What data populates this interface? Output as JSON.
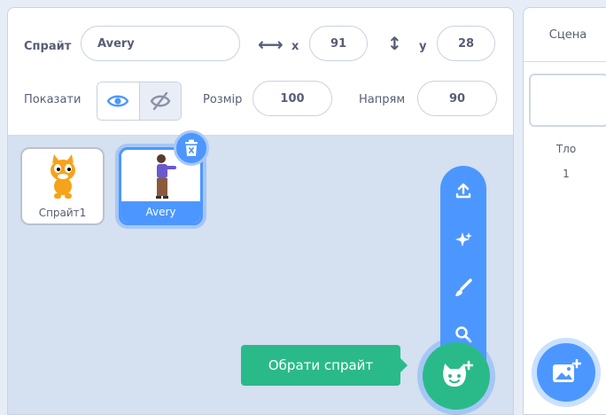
{
  "sprite_info": {
    "sprite_label": "Спрайт",
    "sprite_name": "Avery",
    "x_label": "x",
    "x_value": "91",
    "y_label": "y",
    "y_value": "28",
    "show_label": "Показати",
    "size_label": "Розмір",
    "size_value": "100",
    "direction_label": "Напрям",
    "direction_value": "90"
  },
  "sprites": [
    {
      "name": "Спрайт1",
      "selected": false,
      "icon": "cat-sprite"
    },
    {
      "name": "Avery",
      "selected": true,
      "icon": "avery-sprite"
    }
  ],
  "add_sprite": {
    "tooltip": "Обрати спрайт",
    "menu": [
      "upload-icon",
      "surprise-icon",
      "paint-icon",
      "search-icon"
    ]
  },
  "stage": {
    "header": "Сцена",
    "backdrops_label": "Тло",
    "backdrops_count": "1"
  },
  "colors": {
    "accent": "#4c97ff",
    "green": "#2aba8a",
    "pane_bg": "#d5e0f0"
  }
}
